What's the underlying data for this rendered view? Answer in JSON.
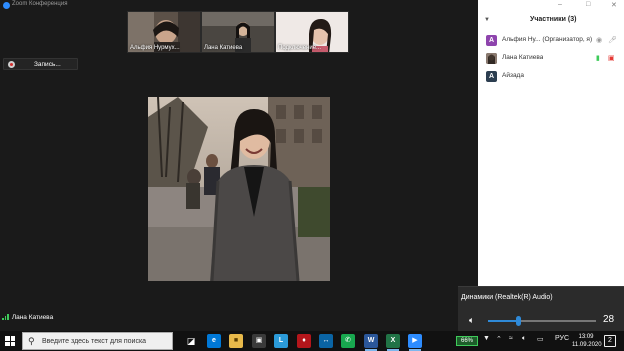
{
  "window": {
    "title": "Zoom Конференция",
    "controls": [
      "–",
      "□",
      "✕"
    ]
  },
  "thumbnails": [
    {
      "name": "Альфия Нурмух..."
    },
    {
      "name": "Лана Катиева"
    },
    {
      "name": "Подключение..."
    }
  ],
  "recording": {
    "label": "Запись..."
  },
  "active_speaker": {
    "name": "Лана Катиева"
  },
  "participants_panel": {
    "title": "Участники (3)",
    "items": [
      {
        "initial": "А",
        "name": "Альфия Ну... (Организатор, я)",
        "color": "#8e44ad"
      },
      {
        "initial": "",
        "name": "Лана Катиева",
        "color": "#6b5a50"
      },
      {
        "initial": "А",
        "name": "Айзада",
        "color": "#2c3e50"
      }
    ]
  },
  "volume_flyout": {
    "device": "Динамики (Realtek(R) Audio)",
    "level": 28
  },
  "taskbar": {
    "search_placeholder": "Введите здесь текст для поиска",
    "battery": "66%",
    "language": "РУС",
    "time": "13:09",
    "date": "11.09.2020",
    "notifications": "2"
  }
}
